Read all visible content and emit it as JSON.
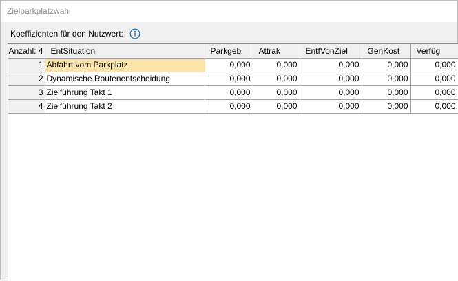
{
  "window": {
    "title": "Zielparkplatzwahl"
  },
  "coefficients_label": "Koeffizienten für den Nutzwert:",
  "info_icon": "info-icon",
  "grid": {
    "count_header": "Anzahl: 4",
    "columns": [
      "EntSituation",
      "Parkgeb",
      "Attrak",
      "EntfVonZiel",
      "GenKost",
      "Verfüg"
    ],
    "rows": [
      {
        "index": "1",
        "situation": "Abfahrt vom Parkplatz",
        "values": [
          "0,000",
          "0,000",
          "0,000",
          "0,000",
          "0,000"
        ],
        "selected": true
      },
      {
        "index": "2",
        "situation": "Dynamische Routenentscheidung",
        "values": [
          "0,000",
          "0,000",
          "0,000",
          "0,000",
          "0,000"
        ],
        "selected": false
      },
      {
        "index": "3",
        "situation": "Zielführung Takt 1",
        "values": [
          "0,000",
          "0,000",
          "0,000",
          "0,000",
          "0,000"
        ],
        "selected": false
      },
      {
        "index": "4",
        "situation": "Zielführung Takt 2",
        "values": [
          "0,000",
          "0,000",
          "0,000",
          "0,000",
          "0,000"
        ],
        "selected": false
      }
    ]
  },
  "colors": {
    "selected_cell": "#fce4a8",
    "info_icon": "#1a73d9"
  }
}
